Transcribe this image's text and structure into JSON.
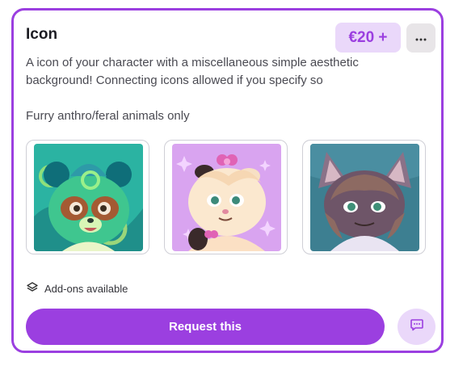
{
  "card": {
    "title": "Icon",
    "price": "€20 +",
    "description": "A icon of your character with a miscellaneous simple aesthetic background! Connecting icons allowed if you specify so",
    "note": "Furry anthro/feral animals only",
    "addons_label": "Add-ons available",
    "request_label": "Request this",
    "more_icon": "ellipsis-icon",
    "chat_icon": "chat-bubble-icon",
    "addons_icon": "layers-icon"
  },
  "colors": {
    "accent": "#9b3fe0",
    "accent_light": "#ead8fa",
    "border": "#cfcfd6"
  },
  "thumbnails": [
    {
      "subject": "green raccoon-like character on teal swirl background"
    },
    {
      "subject": "cream fluffy character with pink bow on lilac background"
    },
    {
      "subject": "grey-brown cat character on blue background"
    }
  ]
}
